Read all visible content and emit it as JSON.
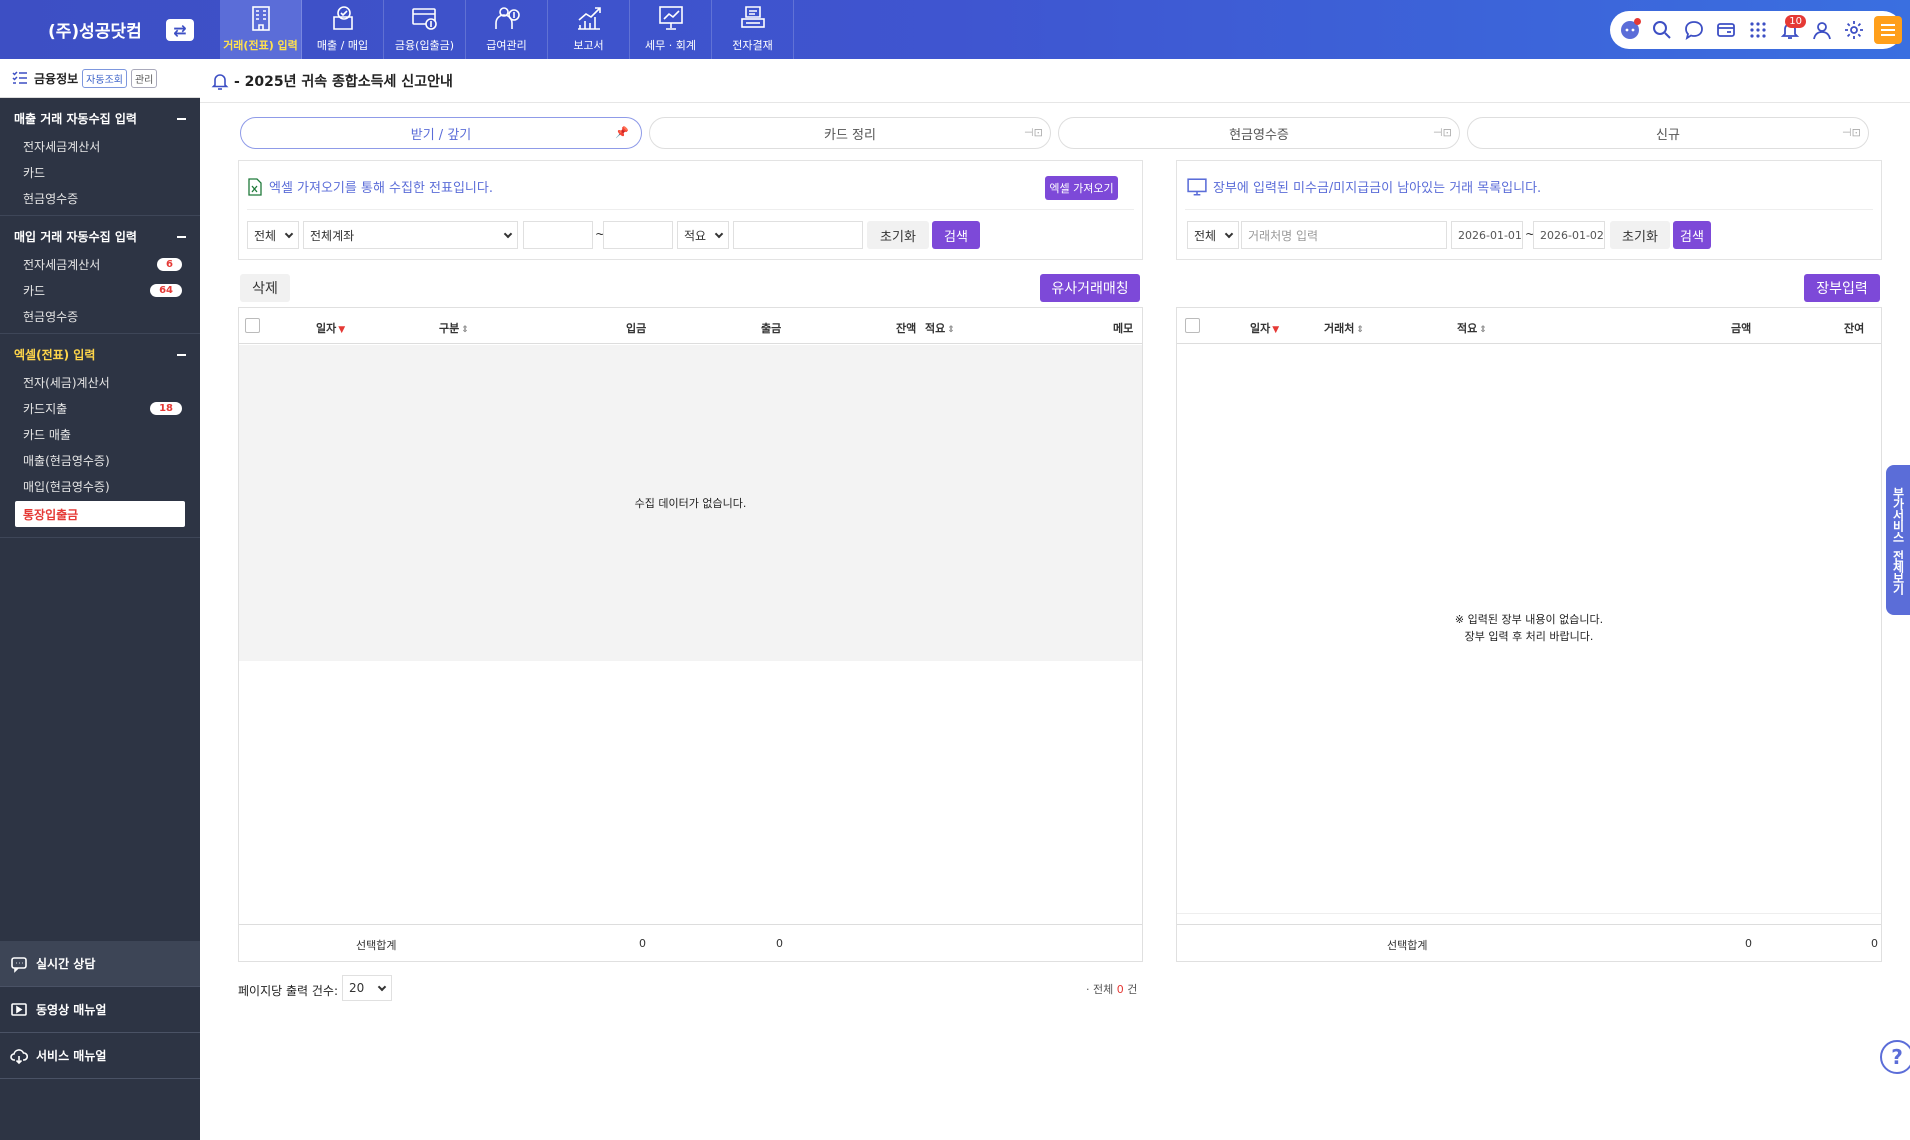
{
  "brand": {
    "name": "(주)성공닷컴",
    "switch_icon": "⇄"
  },
  "top_nav": [
    {
      "label": "거래(전표) 입력",
      "icon": "building-icon",
      "active": true
    },
    {
      "label": "매출 / 매입",
      "icon": "receipt-check-icon"
    },
    {
      "label": "금융(입출금)",
      "icon": "card-money-icon"
    },
    {
      "label": "급여관리",
      "icon": "payroll-icon"
    },
    {
      "label": "보고서",
      "icon": "chart-up-icon"
    },
    {
      "label": "세무 · 회계",
      "icon": "presentation-icon"
    },
    {
      "label": "전자결재",
      "icon": "approval-icon"
    }
  ],
  "top_right": {
    "notification_count": "10"
  },
  "sidebar": {
    "head_title": "금융정보",
    "head_chip_auto": "자동조회",
    "head_chip_manage": "관리",
    "sections": [
      {
        "title": "매출 거래 자동수집 입력",
        "items": [
          {
            "label": "전자세금계산서"
          },
          {
            "label": "카드"
          },
          {
            "label": "현금영수증"
          }
        ]
      },
      {
        "title": "매입 거래 자동수집 입력",
        "items": [
          {
            "label": "전자세금계산서",
            "badge": "6"
          },
          {
            "label": "카드",
            "badge": "64"
          },
          {
            "label": "현금영수증"
          }
        ]
      },
      {
        "title": "엑셀(전표) 입력",
        "items": [
          {
            "label": "전자(세금)계산서"
          },
          {
            "label": "카드지출",
            "badge": "18"
          },
          {
            "label": "카드 매출"
          },
          {
            "label": "매출(현금영수증)"
          },
          {
            "label": "매입(현금영수증)"
          },
          {
            "label": "통장입출금",
            "active": true
          }
        ]
      }
    ],
    "bottom_links": [
      {
        "label": "실시간 상담"
      },
      {
        "label": "동영상 매뉴얼"
      },
      {
        "label": "서비스 매뉴얼"
      }
    ]
  },
  "notice": {
    "text": "- 2025년 귀속 종합소득세 신고안내"
  },
  "tabs": [
    {
      "label": "받기 / 갚기",
      "active": true
    },
    {
      "label": "카드 정리"
    },
    {
      "label": "현금영수증"
    },
    {
      "label": "신규"
    }
  ],
  "left_panel": {
    "message": "엑셀 가져오기를 통해 수집한 전표입니다.",
    "excel_button": "엑셀 가져오기",
    "filter_type": "전체",
    "filter_account": "전체계좌",
    "tilde": "~",
    "filter_summary": "적요",
    "reset_button": "초기화",
    "search_button": "검색",
    "delete_button": "삭제",
    "match_button": "유사거래매칭",
    "columns": [
      "일자",
      "구분",
      "입금",
      "출금",
      "잔액",
      "적요",
      "메모"
    ],
    "empty_text": "수집 데이터가 없습니다.",
    "footer_label": "선택합계",
    "footer_in": "0",
    "footer_out": "0",
    "page_size_label": "페이지당 출력 건수:",
    "page_size_value": "20",
    "total_prefix": "· 전체",
    "total_count": "0",
    "total_suffix": "건"
  },
  "right_panel": {
    "message": "장부에 입력된 미수금/미지급금이 남아있는 거래 목록입니다.",
    "filter_type": "전체",
    "search_placeholder": "거래처명 입력",
    "date_from": "2026-01-01",
    "tilde": "~",
    "date_to": "2026-01-02",
    "reset_button": "초기화",
    "search_button": "검색",
    "ledger_button": "장부입력",
    "columns": [
      "일자",
      "거래처",
      "적요",
      "금액",
      "잔여"
    ],
    "empty_line1": "※ 입력된 장부 내용이 없습니다.",
    "empty_line2": "장부 입력 후 처리 바랍니다.",
    "footer_label": "선택합계",
    "footer_amount": "0",
    "footer_remain": "0"
  },
  "side_tab": {
    "line1": "부가서비스",
    "line2": "전체보기"
  },
  "help": {
    "glyph": "?"
  },
  "colors": {
    "accent": "#7d49d8",
    "nav": "#3d4fc4",
    "sidebar": "#2d3444",
    "highlight": "#ffd54a",
    "badge": "#e53935"
  }
}
